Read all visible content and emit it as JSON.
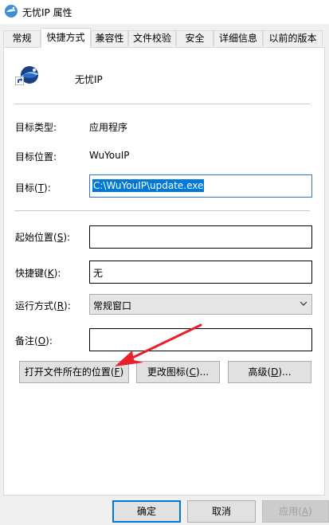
{
  "window": {
    "title": "无忧IP 属性"
  },
  "tabs": [
    {
      "label": "常规"
    },
    {
      "label": "快捷方式"
    },
    {
      "label": "兼容性"
    },
    {
      "label": "文件校验"
    },
    {
      "label": "安全"
    },
    {
      "label": "详细信息"
    },
    {
      "label": "以前的版本"
    }
  ],
  "shortcut": {
    "name": "无忧IP",
    "target_type_label": "目标类型:",
    "target_type_value": "应用程序",
    "target_location_label": "目标位置:",
    "target_location_value": "WuYouIP",
    "target_label_pre": "目标(",
    "target_label_key": "T",
    "target_label_post": "):",
    "target_value": "C:\\WuYouIP\\update.exe",
    "start_in_label_pre": "起始位置(",
    "start_in_label_key": "S",
    "start_in_label_post": "):",
    "start_in_value": "",
    "hotkey_label_pre": "快捷键(",
    "hotkey_label_key": "K",
    "hotkey_label_post": "):",
    "hotkey_value": "无",
    "run_label_pre": "运行方式(",
    "run_label_key": "R",
    "run_label_post": "):",
    "run_value": "常规窗口",
    "comment_label_pre": "备注(",
    "comment_label_key": "O",
    "comment_label_post": "):",
    "comment_value": ""
  },
  "buttons": {
    "open_location_pre": "打开文件所在的位置(",
    "open_location_key": "F",
    "open_location_post": ")",
    "change_icon_pre": "更改图标(",
    "change_icon_key": "C",
    "change_icon_post": ")...",
    "advanced_pre": "高级(",
    "advanced_key": "D",
    "advanced_post": ")..."
  },
  "dialog_buttons": {
    "ok": "确定",
    "cancel": "取消",
    "apply_pre": "应用(",
    "apply_key": "A",
    "apply_post": ")"
  },
  "colors": {
    "selection": "#0078d7",
    "arrow": "#e8202a"
  }
}
